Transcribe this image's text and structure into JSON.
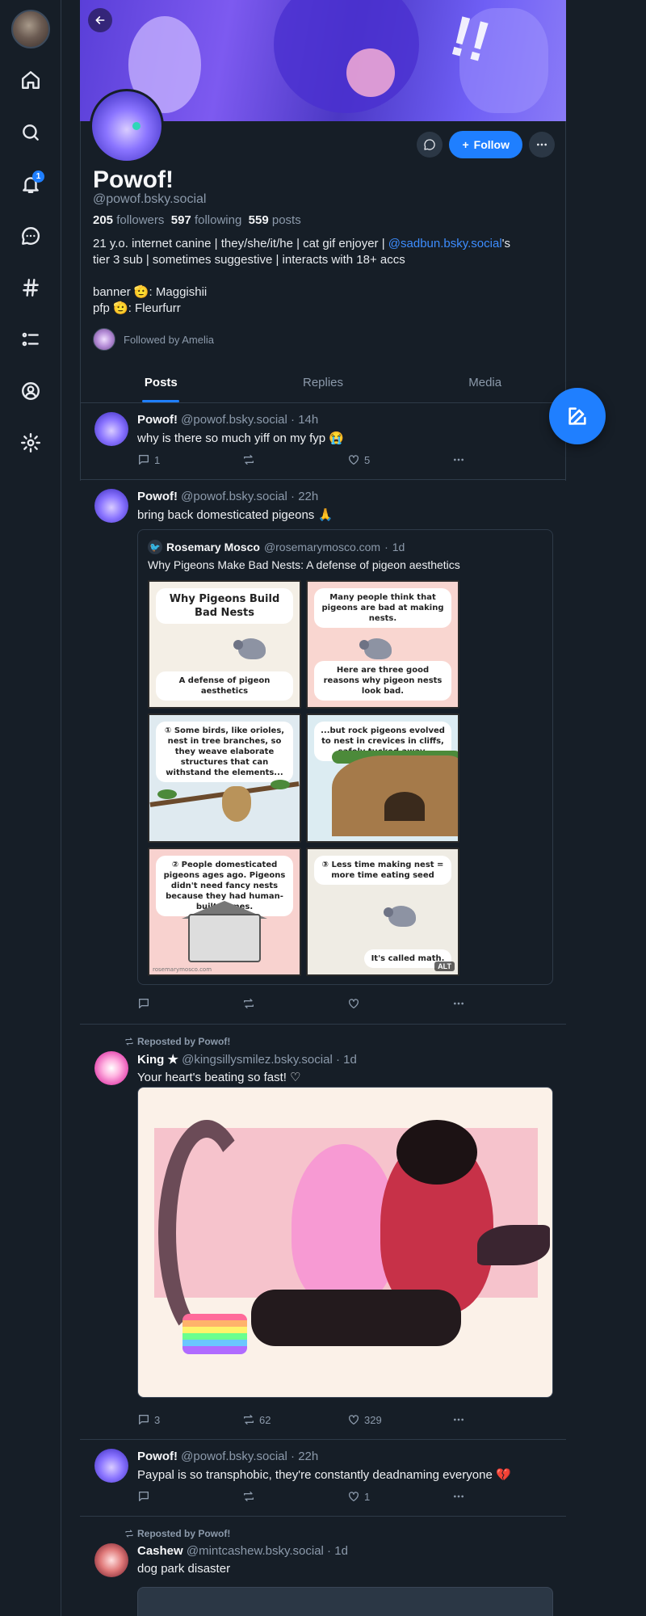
{
  "nav": {
    "notification_count": "1"
  },
  "profile": {
    "display_name": "Powof!",
    "handle": "@powof.bsky.social",
    "followers_count": "205",
    "followers_label": "followers",
    "following_count": "597",
    "following_label": "following",
    "posts_count": "559",
    "posts_label": "posts",
    "bio_line1_pre": "21 y.o. internet canine | they/she/it/he | cat gif enjoyer | ",
    "bio_line1_link": "@sadbun.bsky.social",
    "bio_line1_post": "'s",
    "bio_line2": "tier 3 sub | sometimes suggestive | interacts with 18+ accs",
    "bio_line3": "banner 🫡: Maggishii",
    "bio_line4": "pfp 🫡: Fleurfurr",
    "followed_by": "Followed by Amelia",
    "follow_label": "Follow"
  },
  "tabs": [
    "Posts",
    "Replies",
    "Media"
  ],
  "posts": [
    {
      "author": "Powof!",
      "handle": "@powof.bsky.social",
      "time": "14h",
      "text": "why is there so much yiff on my fyp 😭",
      "replies": "1",
      "reposts": "",
      "likes": "5"
    },
    {
      "author": "Powof!",
      "handle": "@powof.bsky.social",
      "time": "22h",
      "text": "bring back domesticated pigeons 🙏",
      "replies": "",
      "reposts": "",
      "likes": "",
      "quote": {
        "author": "Rosemary Mosco",
        "handle": "@rosemarymosco.com",
        "time": "1d",
        "title": "Why Pigeons Make Bad Nests: A defense of pigeon aesthetics",
        "alt_label": "ALT",
        "panels": [
          {
            "cap": "Why Pigeons Build Bad Nests",
            "cap2": "A defense of pigeon aesthetics"
          },
          {
            "cap": "Many people think that pigeons are bad at making nests.",
            "cap2": "Here are three good reasons why pigeon nests look bad."
          },
          {
            "cap": "① Some birds, like orioles, nest in tree branches, so they weave elaborate structures that can withstand the elements...",
            "cap2": ""
          },
          {
            "cap": "...but rock pigeons evolved to nest in crevices in cliffs, safely tucked away.",
            "cap2": ""
          },
          {
            "cap": "② People domesticated pigeons ages ago. Pigeons didn't need fancy nests because they had human-built homes.",
            "cap2": ""
          },
          {
            "cap": "③ Less time making nest = more time eating seed",
            "cap2": "It's called math."
          }
        ]
      }
    },
    {
      "reposted_by": "Reposted by Powof!",
      "author": "King ★",
      "handle": "@kingsillysmilez.bsky.social",
      "time": "1d",
      "text": "Your heart's beating so fast! ♡",
      "replies": "3",
      "reposts": "62",
      "likes": "329"
    },
    {
      "author": "Powof!",
      "handle": "@powof.bsky.social",
      "time": "22h",
      "text": "Paypal is so transphobic, they're constantly deadnaming everyone 💔",
      "replies": "",
      "reposts": "",
      "likes": "1"
    },
    {
      "reposted_by": "Reposted by Powof!",
      "author": "Cashew",
      "handle": "@mintcashew.bsky.social",
      "time": "1d",
      "text": "dog park disaster"
    }
  ]
}
